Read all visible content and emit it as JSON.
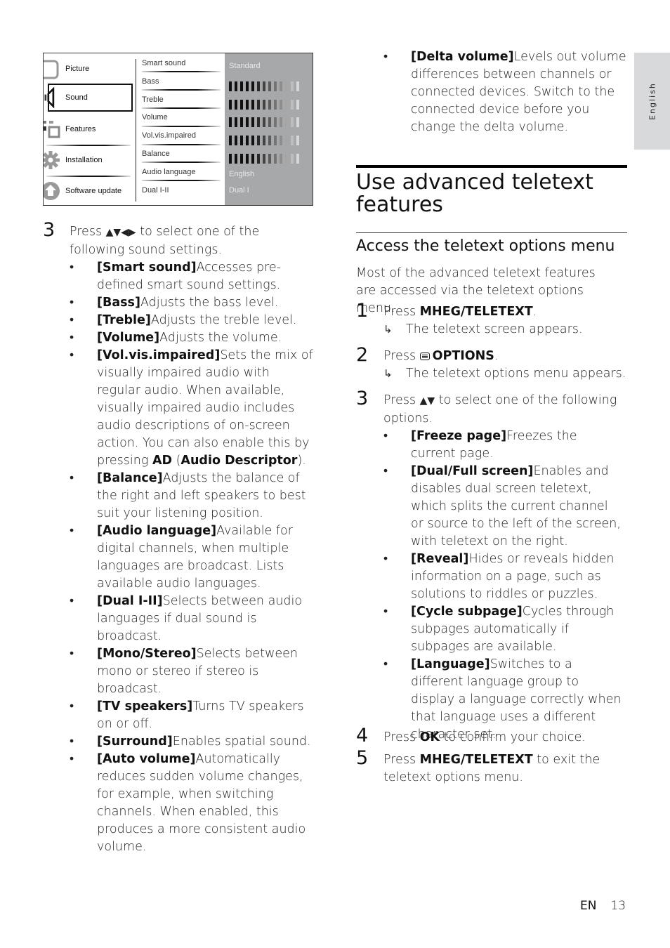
{
  "menu": {
    "categories": [
      {
        "label": "Picture",
        "icon": "picture-icon"
      },
      {
        "label": "Sound",
        "icon": "speaker-icon",
        "selected": true
      },
      {
        "label": "Features",
        "icon": "features-icon"
      },
      {
        "label": "Installation",
        "icon": "gear-icon"
      },
      {
        "label": "Software update",
        "icon": "upload-icon"
      }
    ],
    "settings": [
      "Smart sound",
      "Bass",
      "Treble",
      "Volume",
      "Vol.vis.impaired",
      "Balance",
      "Audio language",
      "Dual I-II"
    ],
    "values": {
      "smart_sound": "Standard",
      "audio_language": "English",
      "dual": "Dual I"
    },
    "slider_segments": 13
  },
  "left": {
    "step3_num": "3",
    "step3_pre": "Press ",
    "step3_arrows": "▲▼◀▶",
    "step3_post": " to select one of the following sound settings.",
    "bullet": "•",
    "items": [
      {
        "term": "[Smart sound]",
        "desc": "Accesses pre-defined smart sound settings."
      },
      {
        "term": "[Bass]",
        "desc": "Adjusts the bass level."
      },
      {
        "term": "[Treble]",
        "desc": "Adjusts the treble level."
      },
      {
        "term": "[Volume]",
        "desc": "Adjusts the volume."
      },
      {
        "term": "[Vol.vis.impaired]",
        "desc": "Sets the mix of visually impaired audio with regular audio. When available, visually impaired audio includes audio descriptions of on-screen action. You can also enable this by pressing ",
        "key1": "AD",
        "mid": " (",
        "key2": "Audio Descriptor",
        "end": ")."
      },
      {
        "term": "[Balance]",
        "desc": "Adjusts the balance of the right and left speakers to best suit your listening position."
      },
      {
        "term": "[Audio language]",
        "desc": "Available for digital channels, when multiple languages are broadcast. Lists available audio languages."
      },
      {
        "term": "[Dual I-II]",
        "desc": "Selects between audio languages if dual sound is broadcast."
      },
      {
        "term": "[Mono/Stereo]",
        "desc": "Selects between mono or stereo if stereo is broadcast."
      },
      {
        "term": "[TV speakers]",
        "desc": "Turns TV speakers on or off."
      },
      {
        "term": "[Surround]",
        "desc": "Enables spatial sound."
      },
      {
        "term": "[Auto volume]",
        "desc": "Automatically reduces sudden volume changes, for example, when switching channels. When enabled, this produces a more consistent audio volume."
      }
    ]
  },
  "right": {
    "delta": {
      "term": "[Delta volume]",
      "desc": "Levels out volume differences between channels or connected devices. Switch to the connected device before you change the delta volume."
    },
    "heading": "Use advanced teletext features",
    "subheading": "Access the teletext options menu",
    "intro": "Most of the advanced teletext features are accessed via the teletext options menu.",
    "steps": [
      {
        "num": "1",
        "pre": "Press ",
        "key": "MHEG/TELETEXT",
        "post": ".",
        "result": "The teletext screen appears."
      },
      {
        "num": "2",
        "pre": "Press ",
        "key": "OPTIONS",
        "post": ".",
        "result": "The teletext options menu appears."
      },
      {
        "num": "3",
        "pre": "Press ",
        "arrows": "▲▼",
        "post": " to select one of the following options."
      },
      {
        "num": "4",
        "pre": "Press ",
        "key": "OK",
        "post": " to confirm your choice."
      },
      {
        "num": "5",
        "pre": "Press ",
        "key": "MHEG/TELETEXT",
        "post": " to exit the teletext options menu."
      }
    ],
    "options": [
      {
        "term": "[Freeze page]",
        "desc": "Freezes the current page."
      },
      {
        "term": "[Dual/Full screen]",
        "desc": "Enables and disables dual screen teletext, which splits the current channel or source to the left of the screen, with teletext on the right."
      },
      {
        "term": "[Reveal]",
        "desc": "Hides or reveals hidden information on a page, such as solutions to riddles or puzzles."
      },
      {
        "term": "[Cycle subpage]",
        "desc": "Cycles through subpages automatically if subpages are available."
      },
      {
        "term": "[Language]",
        "desc": "Switches to a different language group to display a language correctly when that language uses a different character set."
      }
    ],
    "result_arrow": "↳"
  },
  "side_tab": "English",
  "footer": {
    "lang": "EN",
    "page": "13"
  }
}
